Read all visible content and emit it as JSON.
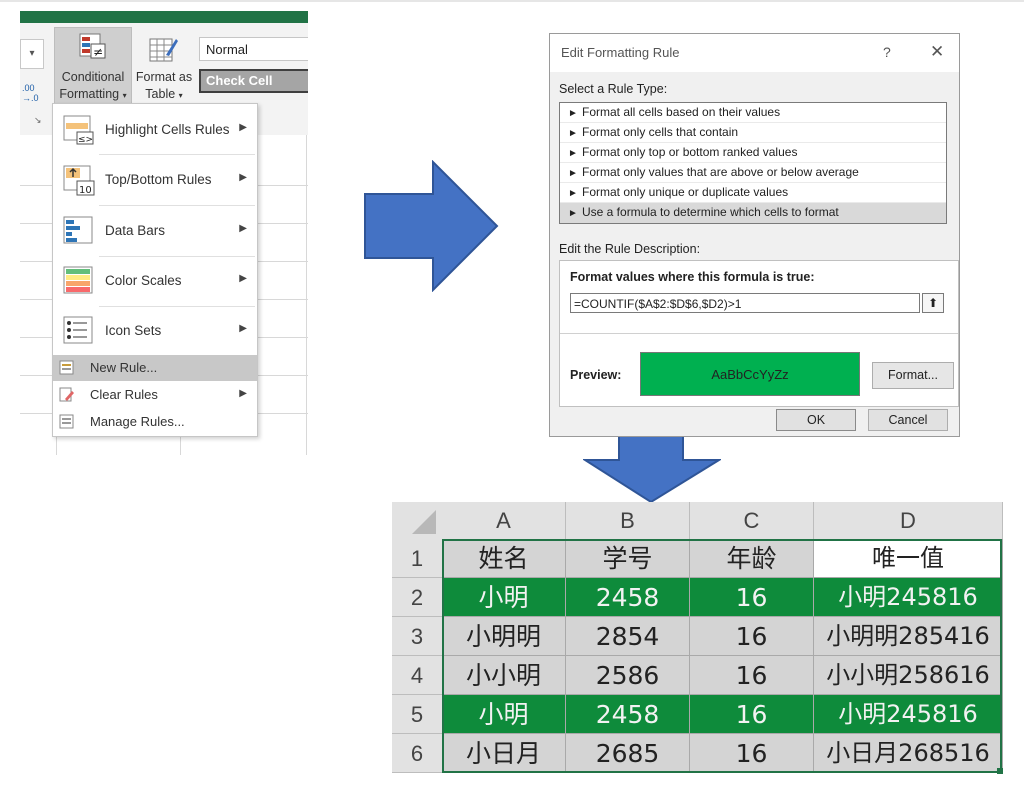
{
  "ribbon": {
    "conditional_formatting": {
      "line1": "Conditional",
      "line2": "Formatting"
    },
    "format_as_table": {
      "line1": "Format as",
      "line2": "Table"
    },
    "styles": {
      "normal": "Normal",
      "check_cell": "Check Cell"
    },
    "number_format_label": ".00\n→.0"
  },
  "cf_menu": {
    "items": [
      {
        "label": "Highlight Cells Rules",
        "submenu": true
      },
      {
        "label": "Top/Bottom Rules",
        "submenu": true,
        "icon_text": "10"
      },
      {
        "label": "Data Bars",
        "submenu": true
      },
      {
        "label": "Color Scales",
        "submenu": true
      },
      {
        "label": "Icon Sets",
        "submenu": true
      },
      {
        "label": "New Rule...",
        "submenu": false,
        "highlighted": true
      },
      {
        "label": "Clear Rules",
        "submenu": true
      },
      {
        "label": "Manage Rules...",
        "submenu": false
      }
    ]
  },
  "dialog": {
    "title": "Edit Formatting Rule",
    "help": "?",
    "close": "✕",
    "select_rule_type_label": "Select a Rule Type:",
    "rule_types": [
      "Format all cells based on their values",
      "Format only cells that contain",
      "Format only top or bottom ranked values",
      "Format only values that are above or below average",
      "Format only unique or duplicate values",
      "Use a formula to determine which cells to format"
    ],
    "selected_rule_index": 5,
    "edit_description_label": "Edit the Rule Description:",
    "formula_label": "Format values where this formula is true:",
    "formula": "=COUNTIF($A$2:$D$6,$D2)>1",
    "preview_label": "Preview:",
    "preview_text": "AaBbCcYyZz",
    "format_button": "Format...",
    "ok_button": "OK",
    "cancel_button": "Cancel"
  },
  "sheet": {
    "columns": [
      "A",
      "B",
      "C",
      "D"
    ],
    "row_numbers": [
      "1",
      "2",
      "3",
      "4",
      "5",
      "6"
    ],
    "rows": [
      [
        "姓名",
        "学号",
        "年龄",
        "唯一值"
      ],
      [
        "小明",
        "2458",
        "16",
        "小明245816"
      ],
      [
        "小明明",
        "2854",
        "16",
        "小明明285416"
      ],
      [
        "小小明",
        "2586",
        "16",
        "小小明258616"
      ],
      [
        "小明",
        "2458",
        "16",
        "小明245816"
      ],
      [
        "小日月",
        "2685",
        "16",
        "小日月268516"
      ]
    ],
    "highlighted_rows": [
      2,
      5
    ]
  },
  "colors": {
    "excel_green": "#217346",
    "highlight_fill": "#0e8b3b",
    "preview_fill": "#00b050",
    "cell_gray": "#d4d4d4",
    "arrow_blue": "#4472c4"
  }
}
